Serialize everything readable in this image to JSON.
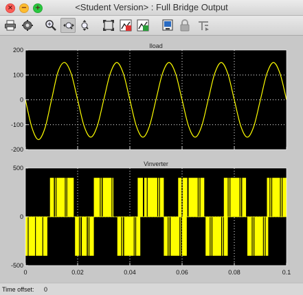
{
  "window": {
    "title": "<Student Version> : Full Bridge Output",
    "close_glyph": "×",
    "min_glyph": "−",
    "max_glyph": "+"
  },
  "toolbar": {
    "buttons": [
      {
        "icon": "print-icon"
      },
      {
        "icon": "gear-icon"
      },
      {
        "icon": "zoom-icon"
      },
      {
        "icon": "zoom-x-icon",
        "pressed": true
      },
      {
        "icon": "zoom-y-icon"
      },
      {
        "icon": "autoscale-icon"
      },
      {
        "icon": "save-axes-icon"
      },
      {
        "icon": "restore-axes-icon"
      },
      {
        "icon": "floating-scope-icon"
      },
      {
        "icon": "lock-icon"
      },
      {
        "icon": "signal-selection-icon"
      }
    ]
  },
  "colors": {
    "plot_bg": "#000000",
    "trace": "#ffff00",
    "frame": "#c8c8c8",
    "tick": "#ffffff"
  },
  "status": {
    "time_offset_label": "Time offset:",
    "time_offset_value": "0"
  },
  "chart_data": [
    {
      "type": "line",
      "title": "Iload",
      "xlim": [
        0,
        0.1
      ],
      "ylim": [
        -200,
        200
      ],
      "yticks": [
        -200,
        -100,
        0,
        100,
        200
      ],
      "ytick_labels": [
        "-200",
        "-100",
        "0",
        "100",
        "200"
      ],
      "grid": true,
      "x": [
        0,
        0.0025,
        0.005,
        0.0075,
        0.01,
        0.0125,
        0.015,
        0.0175,
        0.02,
        0.0225,
        0.025,
        0.0275,
        0.03,
        0.0325,
        0.035,
        0.0375,
        0.04,
        0.0425,
        0.045,
        0.0475,
        0.05,
        0.0525,
        0.055,
        0.0575,
        0.06,
        0.0625,
        0.065,
        0.0675,
        0.07,
        0.0725,
        0.075,
        0.0775,
        0.08,
        0.0825,
        0.085,
        0.0875,
        0.09,
        0.0925,
        0.095,
        0.0975,
        0.1
      ],
      "y": [
        0,
        -112,
        -160,
        -113,
        0,
        113,
        150,
        106,
        0,
        -106,
        -150,
        -106,
        0,
        106,
        150,
        106,
        0,
        -106,
        -150,
        -106,
        0,
        106,
        150,
        106,
        0,
        -106,
        -150,
        -106,
        0,
        106,
        150,
        106,
        0,
        -106,
        -150,
        -106,
        0,
        106,
        150,
        106,
        0
      ]
    },
    {
      "type": "line",
      "title": "Vinverter",
      "xlim": [
        0,
        0.1
      ],
      "ylim": [
        -500,
        500
      ],
      "yticks": [
        -500,
        0,
        500
      ],
      "ytick_labels": [
        "-500",
        "0",
        "500"
      ],
      "xticks": [
        0,
        0.02,
        0.04,
        0.06,
        0.08,
        0.1
      ],
      "xtick_labels": [
        "0",
        "0.02",
        "0.04",
        "0.06",
        "0.08",
        "0.1"
      ],
      "grid": true,
      "amplitude": 400,
      "pulse_segments": [
        [
          0.0,
          0.0009,
          -400
        ],
        [
          0.0012,
          0.0037,
          -400
        ],
        [
          0.004,
          0.0065,
          -400
        ],
        [
          0.0068,
          0.0084,
          -400
        ],
        [
          0.0094,
          0.0109,
          400
        ],
        [
          0.0113,
          0.0116,
          400
        ],
        [
          0.0119,
          0.0151,
          400
        ],
        [
          0.0154,
          0.0157,
          400
        ],
        [
          0.016,
          0.0185,
          400
        ],
        [
          0.019,
          0.0205,
          -400
        ],
        [
          0.0208,
          0.0211,
          -400
        ],
        [
          0.0216,
          0.0235,
          -400
        ],
        [
          0.0239,
          0.0242,
          -400
        ],
        [
          0.0245,
          0.0262,
          -400
        ],
        [
          0.0262,
          0.0285,
          400
        ],
        [
          0.0288,
          0.0292,
          400
        ],
        [
          0.0296,
          0.033,
          400
        ],
        [
          0.0333,
          0.0337,
          400
        ],
        [
          0.0352,
          0.0367,
          -400
        ],
        [
          0.037,
          0.0374,
          -400
        ],
        [
          0.0378,
          0.0415,
          -400
        ],
        [
          0.0418,
          0.0421,
          -400
        ],
        [
          0.0424,
          0.044,
          -400
        ],
        [
          0.043,
          0.045,
          400
        ],
        [
          0.0455,
          0.0465,
          400
        ],
        [
          0.0468,
          0.0505,
          400
        ],
        [
          0.0508,
          0.0512,
          400
        ],
        [
          0.0515,
          0.053,
          400
        ],
        [
          0.053,
          0.0545,
          -400
        ],
        [
          0.0548,
          0.0552,
          -400
        ],
        [
          0.0556,
          0.059,
          -400
        ],
        [
          0.0593,
          0.0596,
          -400
        ],
        [
          0.06,
          0.0618,
          -400
        ],
        [
          0.0585,
          0.0598,
          400
        ],
        [
          0.0602,
          0.062,
          400
        ],
        [
          0.0625,
          0.066,
          400
        ],
        [
          0.0663,
          0.0667,
          400
        ],
        [
          0.067,
          0.0685,
          400
        ],
        [
          0.069,
          0.0706,
          -400
        ],
        [
          0.0709,
          0.0713,
          -400
        ],
        [
          0.0716,
          0.075,
          -400
        ],
        [
          0.0753,
          0.0757,
          -400
        ],
        [
          0.076,
          0.0775,
          -400
        ],
        [
          0.076,
          0.0775,
          400
        ],
        [
          0.0778,
          0.0782,
          400
        ],
        [
          0.0785,
          0.082,
          400
        ],
        [
          0.0823,
          0.0826,
          400
        ],
        [
          0.083,
          0.0845,
          400
        ],
        [
          0.085,
          0.0867,
          -400
        ],
        [
          0.087,
          0.0874,
          -400
        ],
        [
          0.0877,
          0.091,
          -400
        ],
        [
          0.0913,
          0.0917,
          -400
        ],
        [
          0.092,
          0.093,
          -400
        ],
        [
          0.0925,
          0.0935,
          400
        ],
        [
          0.0938,
          0.0942,
          400
        ],
        [
          0.0945,
          0.0975,
          400
        ],
        [
          0.0978,
          0.0982,
          400
        ],
        [
          0.0985,
          0.1,
          400
        ]
      ]
    }
  ]
}
